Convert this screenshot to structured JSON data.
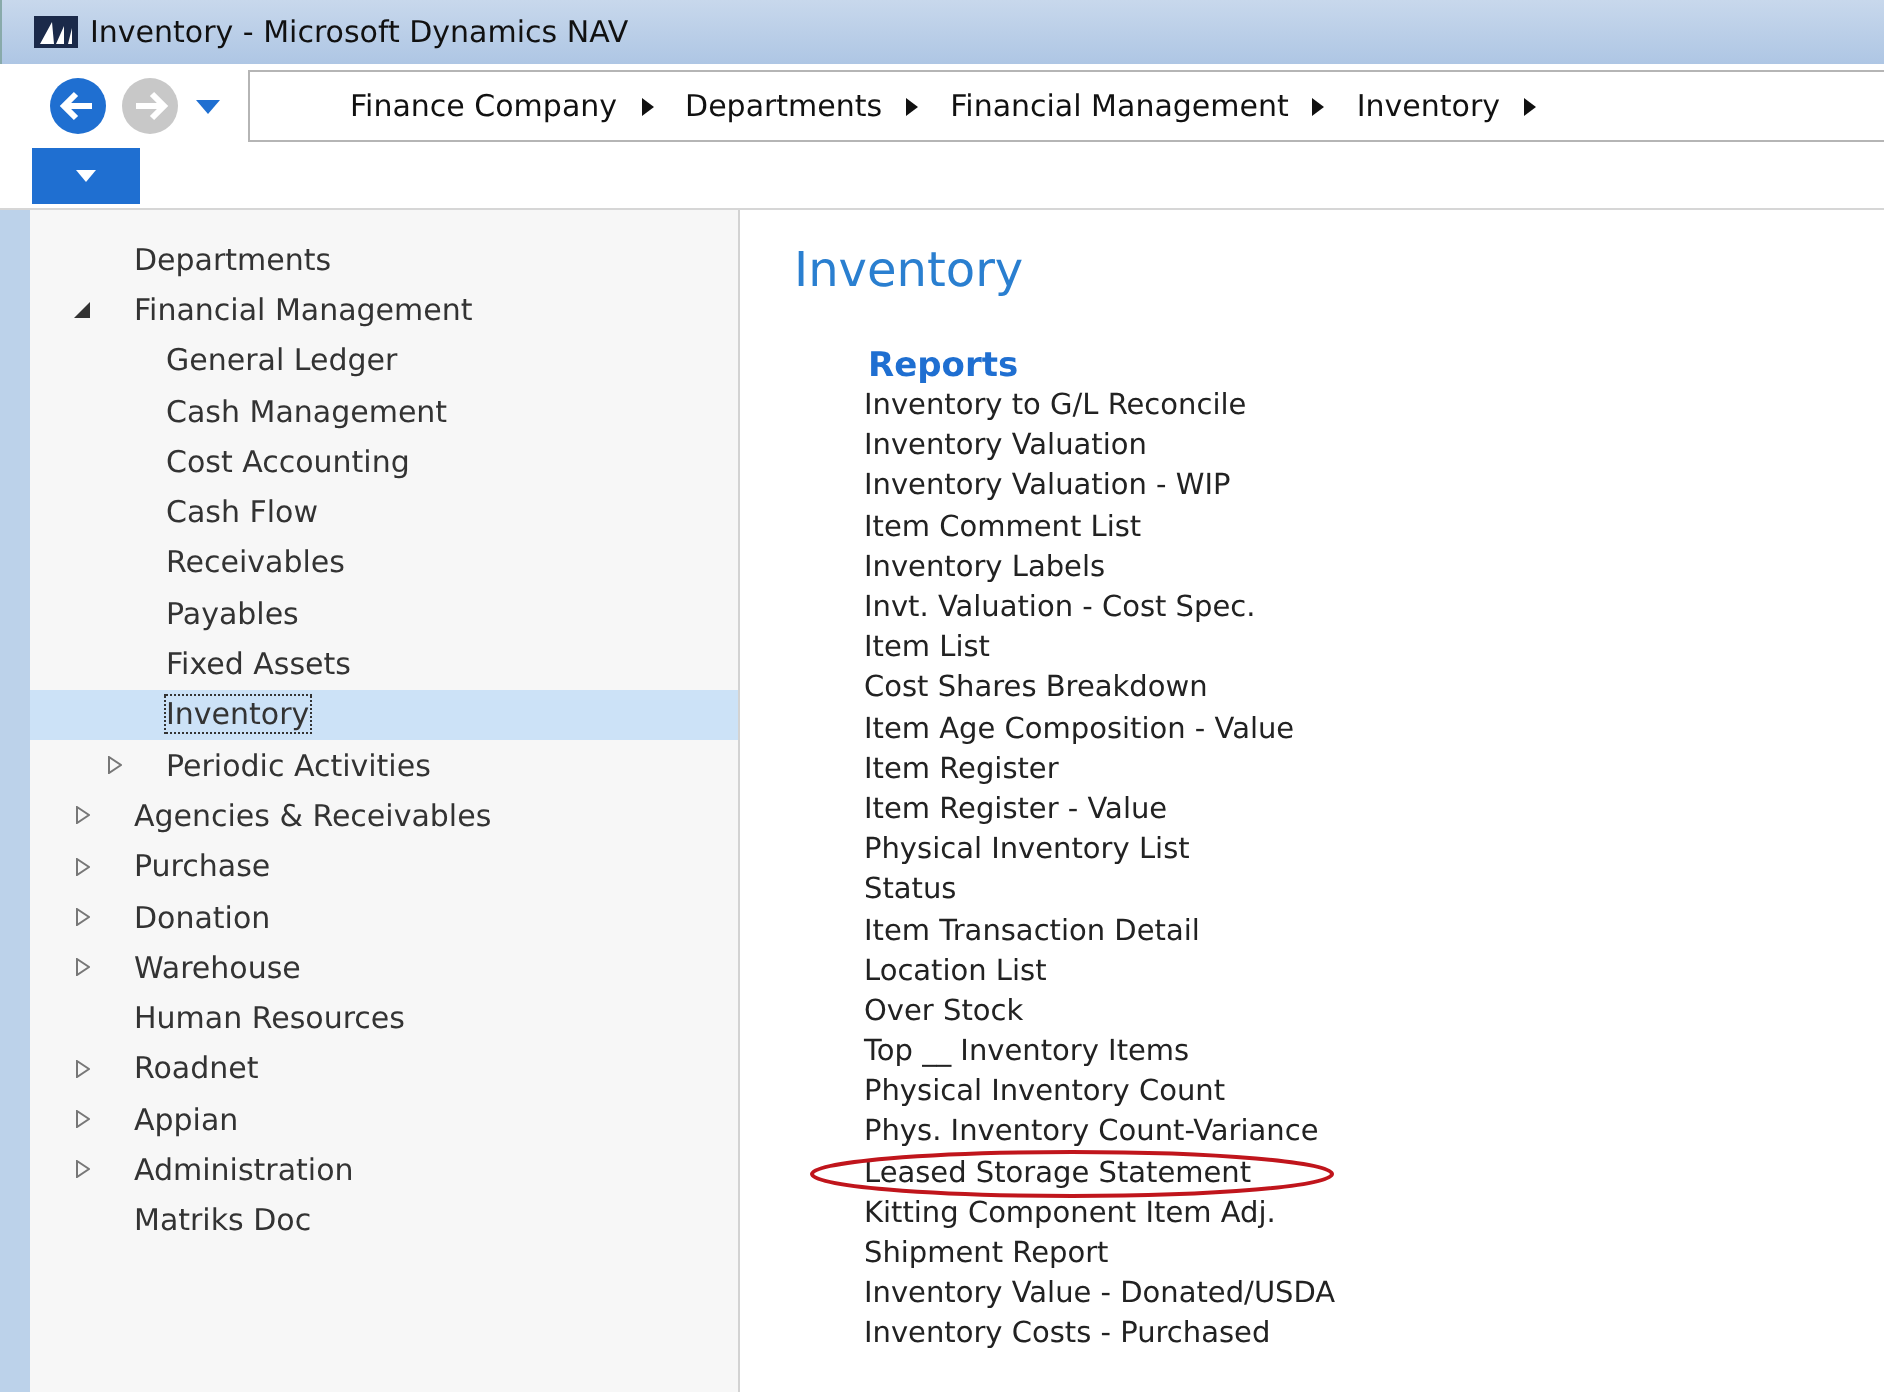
{
  "window": {
    "title": "Inventory - Microsoft Dynamics NAV"
  },
  "breadcrumb": [
    "Finance Company",
    "Departments",
    "Financial Management",
    "Inventory"
  ],
  "sidebar": {
    "items": [
      {
        "label": "Departments",
        "kind": "leaf",
        "selected": false
      },
      {
        "label": "Financial Management",
        "kind": "group",
        "expanded": true,
        "selected": false,
        "children": [
          {
            "label": "General Ledger",
            "kind": "leaf",
            "selected": false
          },
          {
            "label": "Cash Management",
            "kind": "leaf",
            "selected": false
          },
          {
            "label": "Cost Accounting",
            "kind": "leaf",
            "selected": false
          },
          {
            "label": "Cash Flow",
            "kind": "leaf",
            "selected": false
          },
          {
            "label": "Receivables",
            "kind": "leaf",
            "selected": false
          },
          {
            "label": "Payables",
            "kind": "leaf",
            "selected": false
          },
          {
            "label": "Fixed Assets",
            "kind": "leaf",
            "selected": false
          },
          {
            "label": "Inventory",
            "kind": "leaf",
            "selected": true
          },
          {
            "label": "Periodic Activities",
            "kind": "group",
            "expanded": false,
            "selected": false
          }
        ]
      },
      {
        "label": "Agencies & Receivables",
        "kind": "group",
        "expanded": false,
        "selected": false
      },
      {
        "label": "Purchase",
        "kind": "group",
        "expanded": false,
        "selected": false
      },
      {
        "label": "Donation",
        "kind": "group",
        "expanded": false,
        "selected": false
      },
      {
        "label": "Warehouse",
        "kind": "group",
        "expanded": false,
        "selected": false
      },
      {
        "label": "Human Resources",
        "kind": "leaf",
        "selected": false
      },
      {
        "label": "Roadnet",
        "kind": "group",
        "expanded": false,
        "selected": false
      },
      {
        "label": "Appian",
        "kind": "group",
        "expanded": false,
        "selected": false
      },
      {
        "label": "Administration",
        "kind": "group",
        "expanded": false,
        "selected": false
      },
      {
        "label": "Matriks Doc",
        "kind": "leaf",
        "selected": false
      }
    ]
  },
  "page": {
    "title": "Inventory",
    "section": "Reports",
    "reports": [
      {
        "label": "Inventory to G/L Reconcile",
        "circled": false
      },
      {
        "label": "Inventory Valuation",
        "circled": false
      },
      {
        "label": "Inventory Valuation - WIP",
        "circled": false
      },
      {
        "label": "Item Comment List",
        "circled": false
      },
      {
        "label": "Inventory Labels",
        "circled": false
      },
      {
        "label": "Invt. Valuation - Cost Spec.",
        "circled": false
      },
      {
        "label": "Item List",
        "circled": false
      },
      {
        "label": "Cost Shares Breakdown",
        "circled": false
      },
      {
        "label": "Item Age Composition - Value",
        "circled": false
      },
      {
        "label": "Item Register",
        "circled": false
      },
      {
        "label": "Item Register - Value",
        "circled": false
      },
      {
        "label": "Physical Inventory List",
        "circled": false
      },
      {
        "label": "Status",
        "circled": false
      },
      {
        "label": "Item Transaction Detail",
        "circled": false
      },
      {
        "label": "Location List",
        "circled": false
      },
      {
        "label": "Over Stock",
        "circled": false
      },
      {
        "label": "Top __ Inventory Items",
        "circled": false
      },
      {
        "label": "Physical Inventory Count",
        "circled": false
      },
      {
        "label": "Phys. Inventory Count-Variance",
        "circled": false
      },
      {
        "label": "Leased Storage Statement",
        "circled": true
      },
      {
        "label": "Kitting Component Item Adj.",
        "circled": false
      },
      {
        "label": "Shipment Report",
        "circled": false
      },
      {
        "label": "Inventory Value - Donated/USDA",
        "circled": false
      },
      {
        "label": "Inventory Costs - Purchased",
        "circled": false
      }
    ]
  }
}
